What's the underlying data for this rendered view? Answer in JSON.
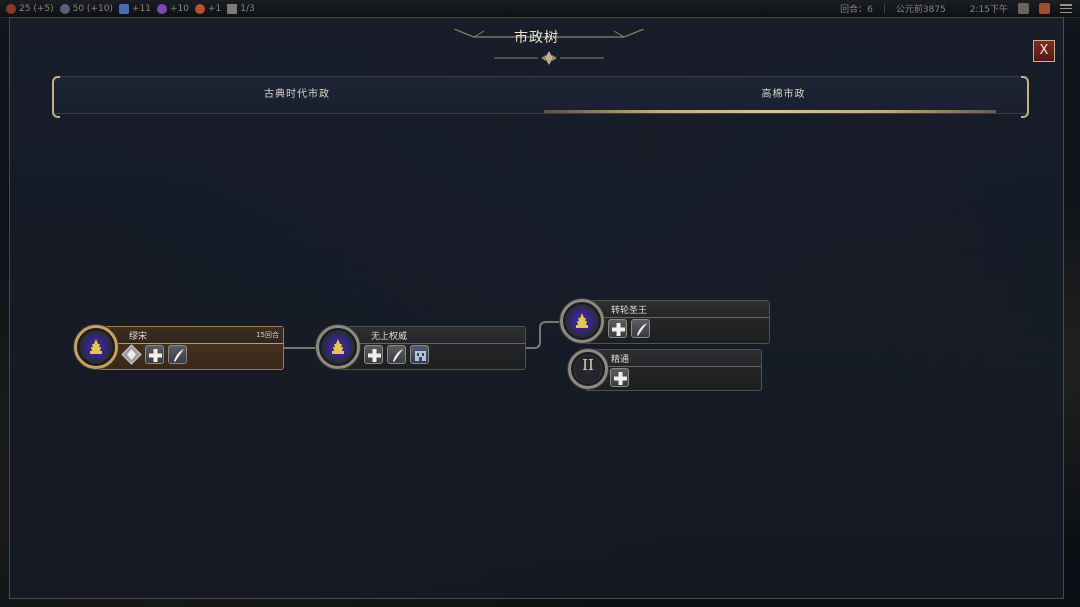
{
  "topbar": {
    "resources": [
      {
        "icon": "gold-icon",
        "text": "25 (+5)",
        "color": "#8a3a2a"
      },
      {
        "icon": "faith-icon",
        "text": "50 (+10)",
        "color": "#5a6278"
      },
      {
        "icon": "science-icon",
        "text": "+11",
        "color": "#4a6bb0"
      },
      {
        "icon": "culture-icon",
        "text": "+10",
        "color": "#7a4bb8"
      },
      {
        "icon": "tourism-icon",
        "text": "+1",
        "color": "#b5532d"
      },
      {
        "icon": "great-people-icon",
        "text": "1/3",
        "color": "#7b7a74"
      }
    ],
    "turn_label": "回合：6",
    "date": "公元前3875",
    "time": "2:15下午"
  },
  "panel": {
    "title": "市政树",
    "close_label": "X"
  },
  "tabs": [
    {
      "label": "古典时代市政",
      "selected": false
    },
    {
      "label": "高棉市政",
      "selected": true
    }
  ],
  "civics": [
    {
      "name": "缪宋",
      "turns": "15回合",
      "active": true,
      "slots": [
        "diamond-card-icon",
        "plus-card-icon",
        "feather-card-icon"
      ]
    },
    {
      "name": "无上权威",
      "turns": "",
      "active": false,
      "slots": [
        "plus-card-icon",
        "feather-card-icon",
        "building-icon"
      ]
    },
    {
      "name": "转轮圣王",
      "turns": "",
      "active": false,
      "slots": [
        "plus-card-icon",
        "feather-card-icon"
      ]
    },
    {
      "name": "精通",
      "turns": "",
      "active": false,
      "roman": "II",
      "slots": [
        "plus-card-icon"
      ]
    }
  ],
  "colors": {
    "accent_gold": "#c4b088",
    "active_brown": "#4a3622",
    "close_red": "#7c2a2a",
    "civic_purple": "#3f2f8c"
  }
}
